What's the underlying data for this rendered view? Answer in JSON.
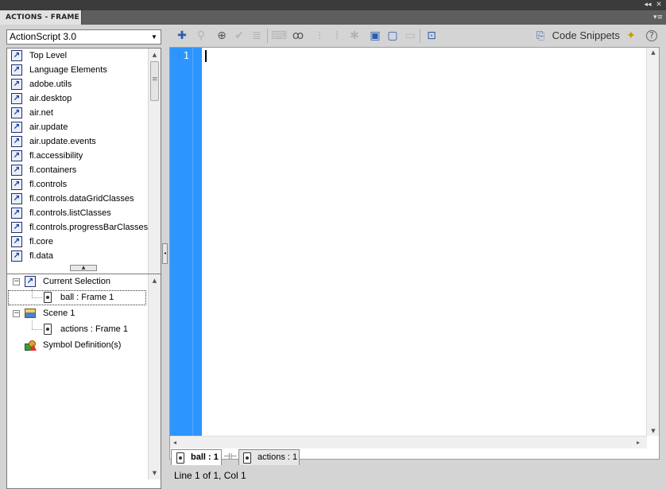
{
  "window": {
    "title": "ACTIONS - FRAME",
    "collapse_glyph": "◂◂",
    "close_glyph": "✕",
    "menu_glyph": "▾≡"
  },
  "left_panel": {
    "version": "ActionScript 3.0",
    "version_arrow": "▼",
    "library_items": [
      "Top Level",
      "Language Elements",
      "adobe.utils",
      "air.desktop",
      "air.net",
      "air.update",
      "air.update.events",
      "fl.accessibility",
      "fl.containers",
      "fl.controls",
      "fl.controls.dataGridClasses",
      "fl.controls.listClasses",
      "fl.controls.progressBarClasses",
      "fl.core",
      "fl.data"
    ],
    "book_glyph": "↗",
    "tree": {
      "current_selection": "Current Selection",
      "current_child": "ball : Frame 1",
      "scene": "Scene 1",
      "scene_child": "actions : Frame 1",
      "symbols": "Symbol Definition(s)"
    }
  },
  "toolbar": {
    "code_snippets": "Code Snippets",
    "icons": [
      "add-statement-icon",
      "find-icon",
      "target-icon",
      "check-syntax-icon",
      "auto-format-icon",
      "code-hint-icon",
      "debug-options-icon",
      "collapse-between-braces-icon",
      "collapse-selection-icon",
      "expand-all-icon",
      "apply-block-comment-icon",
      "apply-line-comment-icon",
      "remove-comment-icon",
      "show-hide-toolbox-icon",
      "code-snippets-icon",
      "script-assist-icon",
      "help-icon"
    ]
  },
  "editor": {
    "line_number": "1"
  },
  "script_tabs": [
    {
      "label": "ball : 1",
      "active": true
    },
    {
      "label": "actions : 1",
      "active": false
    }
  ],
  "status": {
    "text": "Line 1 of 1, Col 1"
  },
  "colors": {
    "gutter": "#2d95ff",
    "panel": "#d4d4d4",
    "titlebar": "#3b3b3b"
  }
}
